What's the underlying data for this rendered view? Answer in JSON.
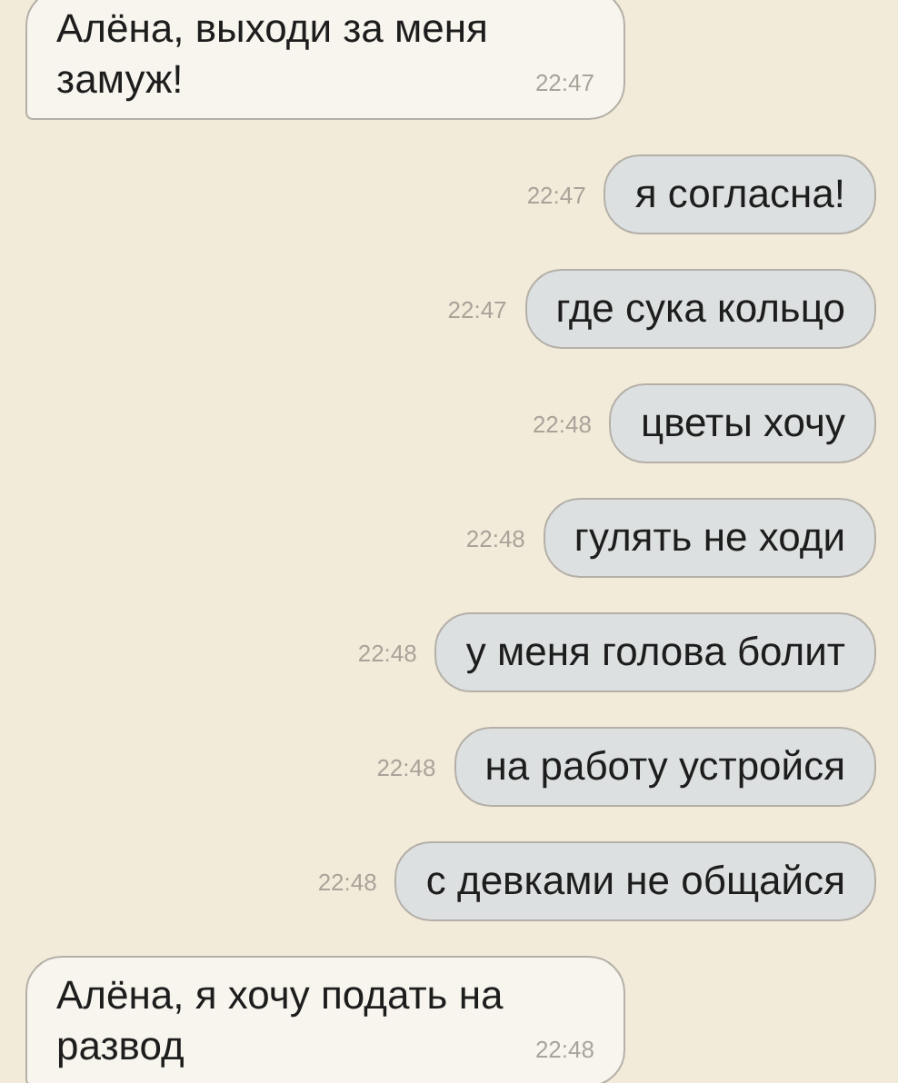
{
  "messages": [
    {
      "kind": "incoming",
      "text": "Алёна, выходи за меня замуж!",
      "time": "22:47"
    },
    {
      "kind": "outgoing",
      "text": "я согласна!",
      "time": "22:47"
    },
    {
      "kind": "outgoing",
      "text": "где сука кольцо",
      "time": "22:47"
    },
    {
      "kind": "outgoing",
      "text": "цветы хочу",
      "time": "22:48"
    },
    {
      "kind": "outgoing",
      "text": "гулять не ходи",
      "time": "22:48"
    },
    {
      "kind": "outgoing",
      "text": "у меня голова болит",
      "time": "22:48"
    },
    {
      "kind": "outgoing",
      "text": "на работу устройся",
      "time": "22:48"
    },
    {
      "kind": "outgoing",
      "text": "с девками не общайся",
      "time": "22:48"
    },
    {
      "kind": "incoming",
      "text": "Алёна, я хочу подать на развод",
      "time": "22:48"
    }
  ]
}
